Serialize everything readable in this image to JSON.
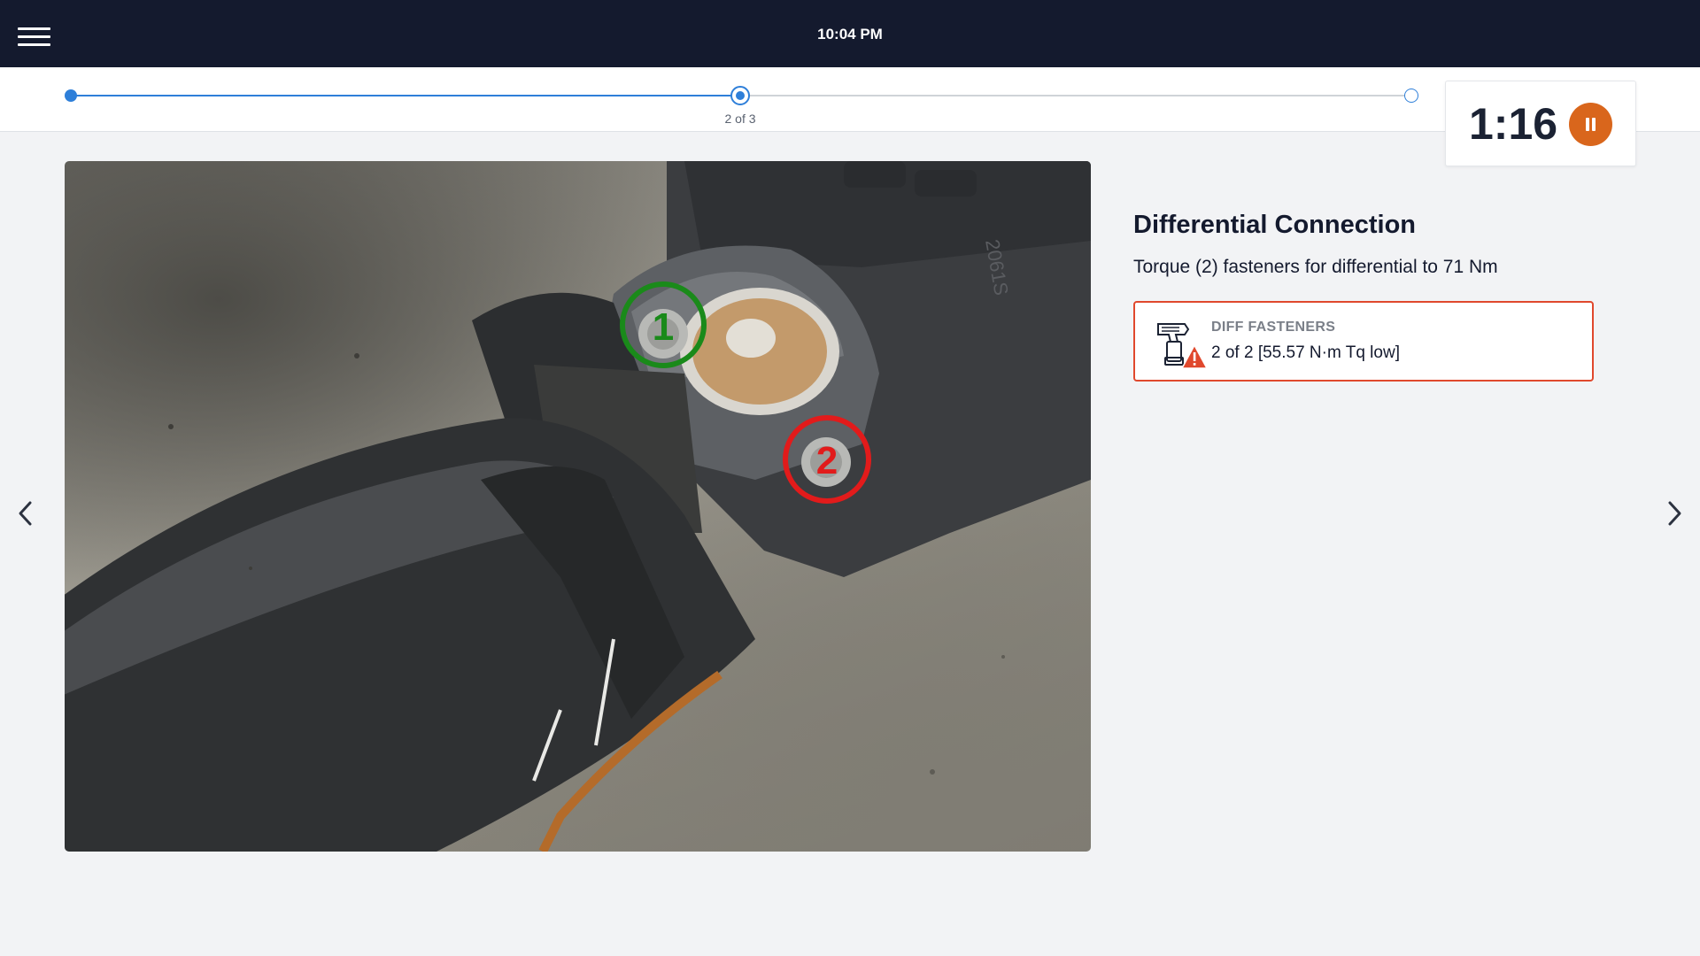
{
  "header": {
    "time": "10:04 PM",
    "menu_icon": "hamburger-menu-icon"
  },
  "progress": {
    "current_step": 2,
    "total_steps": 3,
    "label": "2 of 3",
    "accent_color": "#2e7fd9"
  },
  "timer": {
    "display": "1:16",
    "pause_icon": "pause-icon",
    "pause_color": "#d9661c"
  },
  "photo": {
    "markers": [
      {
        "label": "1",
        "status_color": "#1a8a1a"
      },
      {
        "label": "2",
        "status_color": "#e21b1b"
      }
    ],
    "casting_text": "2061S"
  },
  "step": {
    "title": "Differential Connection",
    "description": "Torque (2) fasteners for differential to 71 Nm"
  },
  "task": {
    "title": "DIFF FASTENERS",
    "status": "2 of 2 [55.57 N·m Tq low]",
    "tool_icon": "torque-wrench-icon",
    "warning_icon": "warning-icon",
    "warning_color": "#e0482d"
  },
  "nav": {
    "prev_icon": "chevron-left-icon",
    "next_icon": "chevron-right-icon"
  }
}
